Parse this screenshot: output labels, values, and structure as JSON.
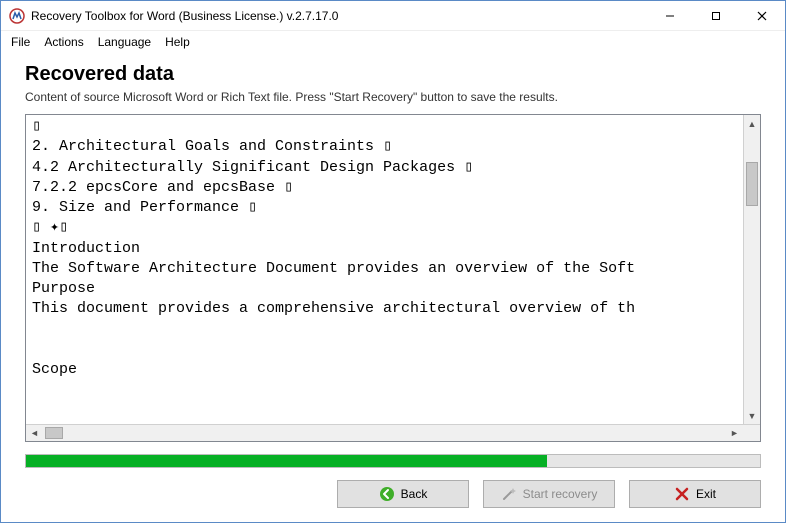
{
  "title": "Recovery Toolbox for Word (Business License.) v.2.7.17.0",
  "menu": {
    "file": "File",
    "actions": "Actions",
    "language": "Language",
    "help": "Help"
  },
  "heading": "Recovered data",
  "subtext": "Content of source Microsoft Word or Rich Text file. Press \"Start Recovery\" button to save the results.",
  "document_lines": [
    "▯",
    "2. Architectural Goals and Constraints ▯",
    "4.2 Architecturally Significant Design Packages ▯",
    "7.2.2 epcsCore and epcsBase ▯",
    "9. Size and Performance ▯",
    "▯ ✦▯",
    "Introduction",
    "The Software Architecture Document provides an overview of the Soft",
    "Purpose",
    "This document provides a comprehensive architectural overview of th",
    "",
    "",
    "Scope"
  ],
  "progress_percent": 71,
  "buttons": {
    "back": "Back",
    "start": "Start recovery",
    "exit": "Exit"
  }
}
